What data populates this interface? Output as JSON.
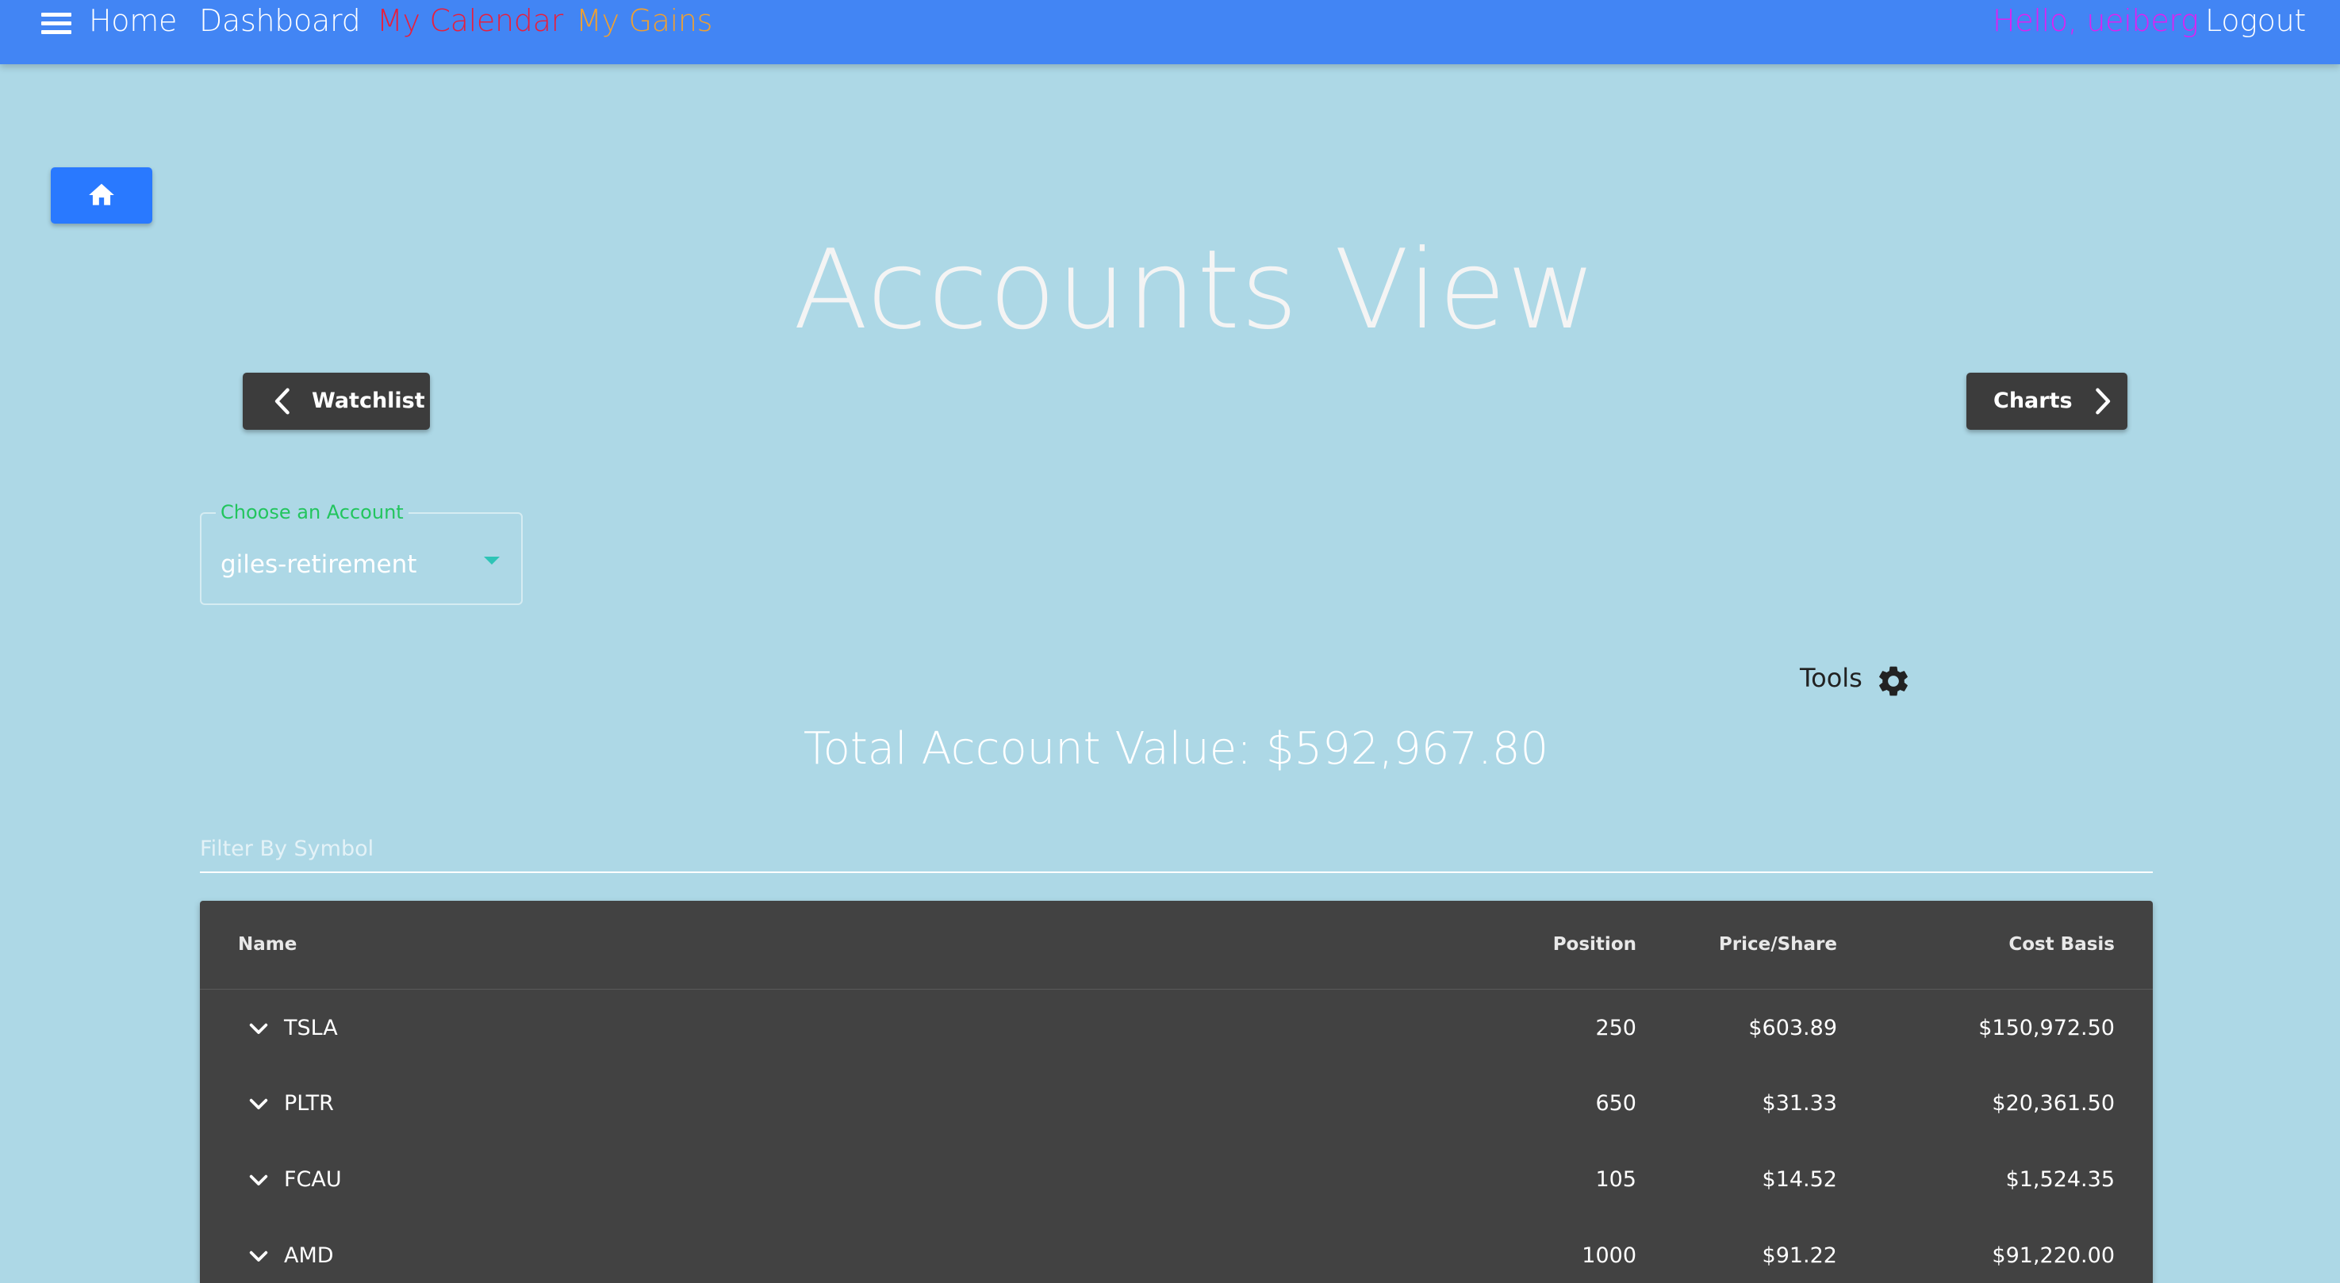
{
  "nav": {
    "home": "Home",
    "dashboard": "Dashboard",
    "calendar": "My Calendar",
    "gains": "My Gains",
    "greeting": "Hello, ueiberg",
    "logout": "Logout"
  },
  "page": {
    "title": "Accounts View",
    "prev_button": "Watchlist",
    "next_button": "Charts"
  },
  "account_select": {
    "label": "Choose an Account",
    "value": "giles-retirement"
  },
  "tools": {
    "label": "Tools"
  },
  "total": {
    "text": "Total Account Value: $592,967.80"
  },
  "filter": {
    "placeholder": "Filter By Symbol",
    "value": ""
  },
  "table": {
    "headers": {
      "name": "Name",
      "position": "Position",
      "price": "Price/Share",
      "cost_basis": "Cost Basis"
    },
    "rows": [
      {
        "symbol": "TSLA",
        "position": "250",
        "price": "$603.89",
        "cost_basis": "$150,972.50"
      },
      {
        "symbol": "PLTR",
        "position": "650",
        "price": "$31.33",
        "cost_basis": "$20,361.50"
      },
      {
        "symbol": "FCAU",
        "position": "105",
        "price": "$14.52",
        "cost_basis": "$1,524.35"
      },
      {
        "symbol": "AMD",
        "position": "1000",
        "price": "$91.22",
        "cost_basis": "$91,220.00"
      }
    ]
  },
  "colors": {
    "background": "#add8e6",
    "app_bar": "#4285f4",
    "calendar_link": "#e91e3c",
    "gains_link": "#f0a030",
    "greeting": "#e020f0",
    "home_button": "#2979ff",
    "dark_button": "#3c3c3c",
    "table_background": "#424242",
    "select_label": "#22c55e"
  },
  "icons": {
    "menu": "menu-icon",
    "home": "home-icon",
    "prev": "chevron-left-icon",
    "next": "chevron-right-icon",
    "dropdown": "caret-down-icon",
    "tools": "gear-icon",
    "expand_row": "chevron-down-icon"
  }
}
